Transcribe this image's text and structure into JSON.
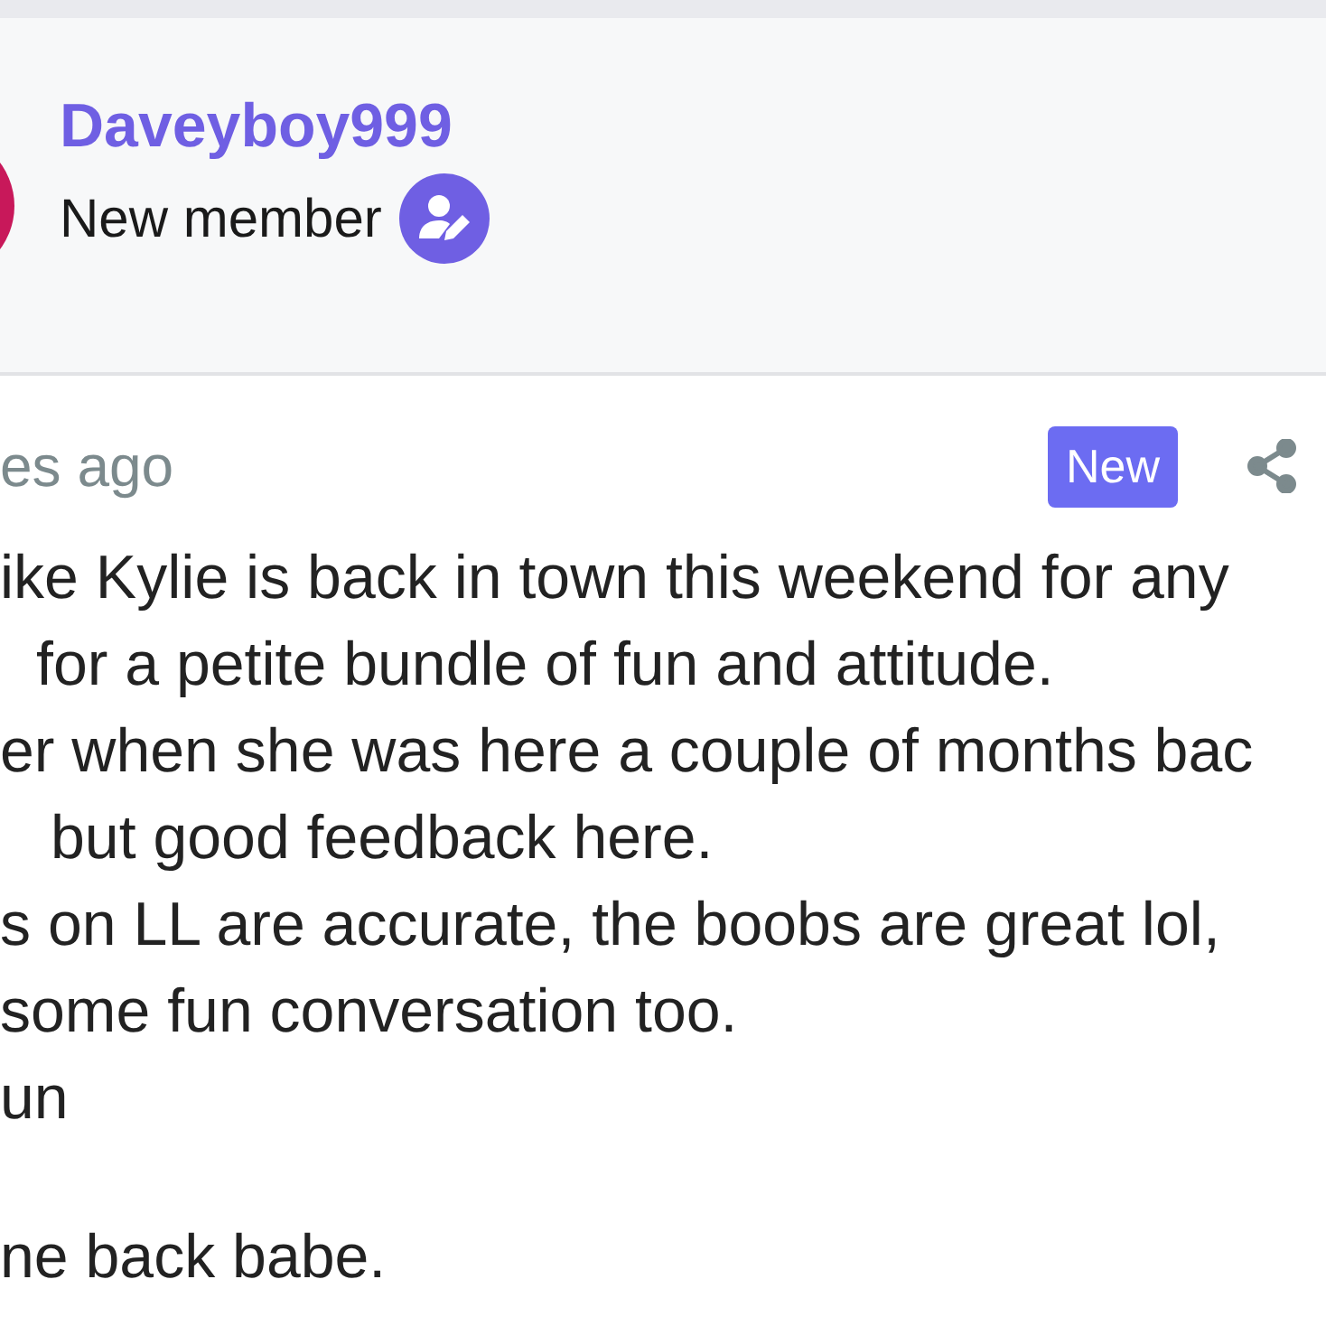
{
  "author": {
    "username": "Daveyboy999",
    "role": "New member"
  },
  "post": {
    "time": "es ago",
    "badge": "New",
    "paragraphs": [
      [
        "ike Kylie is back in town this weekend for any",
        "for a petite bundle of fun and attitude.",
        "er when she was here a couple of months bac",
        "but good feedback here.",
        "s on LL are accurate, the boobs are great lol,",
        "some fun conversation too.",
        "un"
      ],
      [
        "ne back babe."
      ]
    ]
  }
}
